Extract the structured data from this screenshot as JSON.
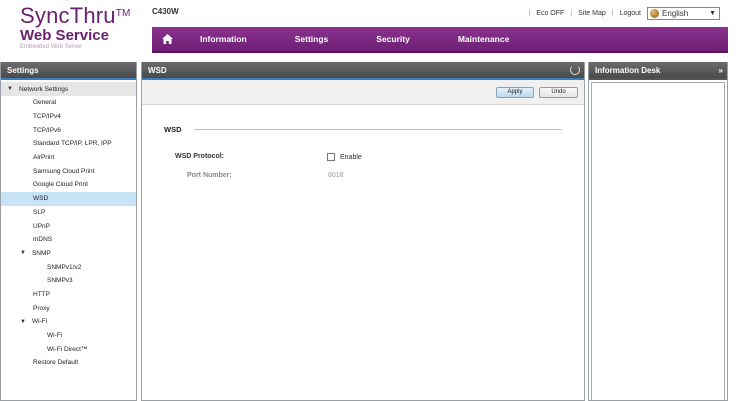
{
  "header": {
    "logo_title": "SyncThru",
    "logo_tm": "TM",
    "logo_subtitle": "Web Service",
    "logo_tagline": "Embedded Web Server",
    "model": "C430W",
    "links": {
      "eco": "Eco OFF",
      "sitemap": "Site Map",
      "logout": "Logout"
    },
    "language": "English"
  },
  "nav": {
    "items": [
      "Information",
      "Settings",
      "Security",
      "Maintenance"
    ]
  },
  "sidebar": {
    "title": "Settings",
    "root": "Network Settings",
    "items": [
      "General",
      "TCP/IPv4",
      "TCP/IPv6",
      "Standard TCP/IP, LPR, IPP",
      "AirPrint",
      "Samsung Cloud Print",
      "Google Cloud Print",
      "WSD",
      "SLP",
      "UPnP",
      "mDNS"
    ],
    "snmp": {
      "label": "SNMP",
      "children": [
        "SNMPv1/v2",
        "SNMPv3"
      ]
    },
    "items2": [
      "HTTP",
      "Proxy"
    ],
    "wifi": {
      "label": "Wi-Fi",
      "children": [
        "Wi-Fi",
        "Wi-Fi Direct™"
      ]
    },
    "items3": [
      "Restore Default"
    ],
    "selected": "WSD"
  },
  "main": {
    "title": "WSD",
    "apply_label": "Apply",
    "undo_label": "Undo",
    "section_title": "WSD",
    "wsd_protocol_label": "WSD Protocol:",
    "enable_label": "Enable",
    "enable_checked": false,
    "port_label": "Port Number:",
    "port_value": "8018"
  },
  "info_desk": {
    "title": "Information Desk"
  },
  "colors": {
    "brand_purple": "#6e1f74",
    "panel_header": "#4a4a4a",
    "selected_row": "#c7e3f6",
    "accent_blue": "#3a7fc0"
  }
}
